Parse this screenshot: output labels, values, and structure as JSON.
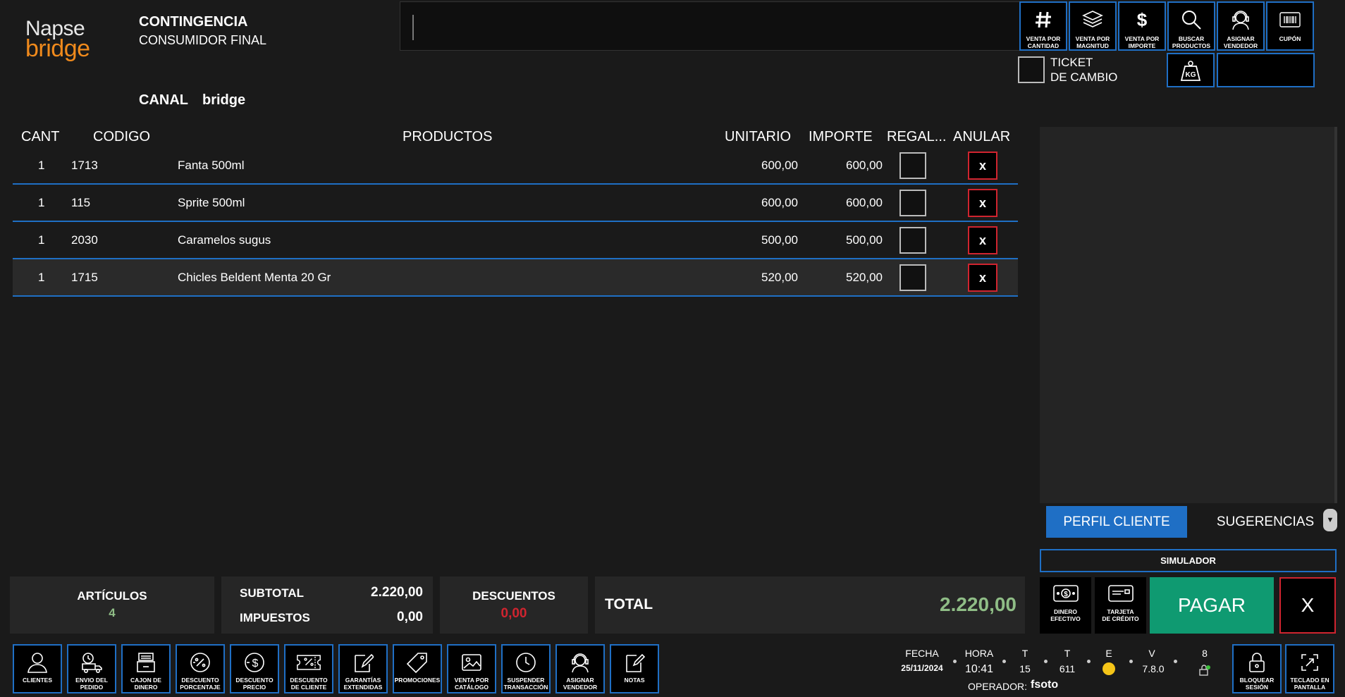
{
  "header": {
    "logo_line1": "Napse",
    "logo_line2": "bridge",
    "mode": "CONTINGENCIA",
    "customer": "CONSUMIDOR FINAL",
    "canal_label": "CANAL",
    "canal_value": "bridge",
    "search": {
      "value": "",
      "placeholder": ""
    }
  },
  "top_buttons": [
    {
      "name": "venta-por-cantidad",
      "icon": "hash-icon",
      "label": "VENTA POR\nCANTIDAD"
    },
    {
      "name": "venta-por-magnitud",
      "icon": "layers-icon",
      "label": "VENTA POR\nMAGNITUD"
    },
    {
      "name": "venta-por-importe",
      "icon": "dollar-icon",
      "label": "VENTA POR\nIMPORTE"
    },
    {
      "name": "buscar-productos",
      "icon": "magnifier-icon",
      "label": "BUSCAR\nPRODUCTOS"
    },
    {
      "name": "asignar-vendedor-top",
      "icon": "headset-icon",
      "label": "ASIGNAR\nVENDEDOR"
    },
    {
      "name": "cupon",
      "icon": "barcode-icon",
      "label": "CUPÓN"
    }
  ],
  "ticket_cambio": {
    "line1": "TICKET",
    "line2": "DE CAMBIO",
    "checked": false
  },
  "kg_button": {
    "icon": "weight-icon",
    "label": "KG"
  },
  "table": {
    "headers": {
      "cant": "CANT",
      "codigo": "CODIGO",
      "productos": "PRODUCTOS",
      "unitario": "UNITARIO",
      "importe": "IMPORTE",
      "regalo": "REGAL...",
      "anular": "ANULAR"
    },
    "rows": [
      {
        "cant": "1",
        "codigo": "1713",
        "producto": "Fanta 500ml",
        "unitario": "600,00",
        "importe": "600,00",
        "anular": "x"
      },
      {
        "cant": "1",
        "codigo": "115",
        "producto": "Sprite 500ml",
        "unitario": "600,00",
        "importe": "600,00",
        "anular": "x"
      },
      {
        "cant": "1",
        "codigo": "2030",
        "producto": "Caramelos sugus",
        "unitario": "500,00",
        "importe": "500,00",
        "anular": "x"
      },
      {
        "cant": "1",
        "codigo": "1715",
        "producto": "Chicles Beldent Menta 20 Gr",
        "unitario": "520,00",
        "importe": "520,00",
        "anular": "x"
      }
    ]
  },
  "side": {
    "tab_perfil": "PERFIL CLIENTE",
    "tab_sugerencias": "SUGERENCIAS",
    "simulador": "SIMULADOR",
    "cash_label": "DINERO\nEFECTIVO",
    "card_label": "TARJETA\nDE CRÉDITO",
    "pay_label": "PAGAR",
    "cancel_label": "X"
  },
  "totals": {
    "articulos_label": "ARTÍCULOS",
    "articulos_value": "4",
    "subtotal_label": "SUBTOTAL",
    "subtotal_value": "2.220,00",
    "impuestos_label": "IMPUESTOS",
    "impuestos_value": "0,00",
    "descuentos_label": "DESCUENTOS",
    "descuentos_value": "0,00",
    "total_label": "TOTAL",
    "total_value": "2.220,00"
  },
  "bottom_buttons": [
    {
      "name": "clientes",
      "icon": "user-icon",
      "label": "CLIENTES"
    },
    {
      "name": "envio-del-pedido",
      "icon": "truck-icon",
      "label": "ENVIO DEL\nPEDIDO"
    },
    {
      "name": "cajon-de-dinero",
      "icon": "drawer-icon",
      "label": "CAJON DE\nDINERO"
    },
    {
      "name": "descuento-porcentaje",
      "icon": "percent-circle-icon",
      "label": "DESCUENTO\nPORCENTAJE"
    },
    {
      "name": "descuento-precio",
      "icon": "dollar-circle-icon",
      "label": "DESCUENTO\nPRECIO"
    },
    {
      "name": "descuento-de-cliente",
      "icon": "coupon-icon",
      "label": "DESCUENTO\nDE CLIENTE"
    },
    {
      "name": "garantias-extendidas",
      "icon": "edit-doc-icon",
      "label": "GARANTÍAS\nEXTENDIDAS"
    },
    {
      "name": "promociones",
      "icon": "tag-icon",
      "label": "PROMOCIONES"
    },
    {
      "name": "venta-por-catalogo",
      "icon": "image-icon",
      "label": "VENTA POR\nCATÁLOGO"
    },
    {
      "name": "suspender-transaccion",
      "icon": "clock-icon",
      "label": "SUSPENDER\nTRANSACCIÓN"
    },
    {
      "name": "asignar-vendedor-bottom",
      "icon": "headset-icon",
      "label": "ASIGNAR\nVENDEDOR"
    },
    {
      "name": "notas",
      "icon": "note-icon",
      "label": "NOTAS"
    }
  ],
  "status": {
    "fecha_label": "FECHA",
    "fecha_value": "25/11/2024",
    "hora_label": "HORA",
    "hora_value": "10:41",
    "t1_label": "T",
    "t1_value": "15",
    "t2_label": "T",
    "t2_value": "611",
    "e_label": "E",
    "v_label": "V",
    "v_value": "7.8.0",
    "n_label": "8",
    "operador_label": "OPERADOR:",
    "operador_value": "fsoto"
  },
  "right_bottom_buttons": [
    {
      "name": "bloquear-sesion",
      "icon": "lock-icon",
      "label": "BLOQUEAR\nSESIÓN"
    },
    {
      "name": "teclado-en-pantalla",
      "icon": "expand-icon",
      "label": "TECLADO EN\nPANTALLA"
    }
  ],
  "colors": {
    "background": "#1a1a1a",
    "accent_blue": "#1f6fc5",
    "danger_red": "#d0242f",
    "pay_green": "#0f9a71",
    "total_green": "#8fbd86",
    "logo_orange": "#f08a1c"
  }
}
